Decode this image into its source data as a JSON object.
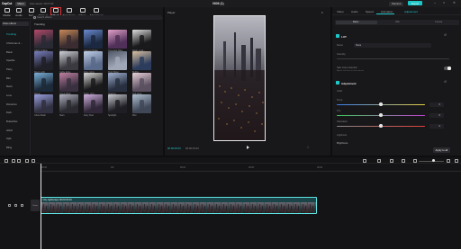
{
  "titlebar": {
    "logo": "CapCut",
    "menu": "Menu",
    "autosave": "Auto saved: 16:07:00",
    "title": "0808 (1)",
    "shortcut": "Shortcut",
    "export": "Export"
  },
  "toolbar": {
    "items": [
      {
        "label": "Media"
      },
      {
        "label": "Audio"
      },
      {
        "label": "Text"
      },
      {
        "label": "Stickers"
      },
      {
        "label": "Effects"
      },
      {
        "label": "Transitions"
      },
      {
        "label": "Filters"
      },
      {
        "label": "Adjustment"
      }
    ]
  },
  "sidebar": {
    "head": "Video effects",
    "items": [
      "Trending",
      "Christmas & ...",
      "Basic",
      "Sparkle",
      "Party",
      "Blur",
      "Retro",
      "Love",
      "Distortion",
      "Dark",
      "Butterflies",
      "Glitch",
      "Split",
      "Bling"
    ]
  },
  "search": {
    "placeholder": "Search effects"
  },
  "effects": {
    "section": "Trending",
    "cards": [
      "Glitch Collage",
      "Shaking",
      "Camera Shake",
      "Cinematic Bars",
      "Flash_Lock...",
      "Disco Light",
      "Cable Edge",
      "Edge Glow",
      "Fluid Water",
      "Bubble",
      "Ripple",
      "Cloud Mask",
      "Flash_lock...",
      "Shaking",
      "Soft Glow",
      "Ghost Flash",
      "Stars",
      "Fairy Dust",
      "Spotlight",
      "Mist"
    ]
  },
  "player": {
    "label": "Player",
    "current_time": "00:00:00:00",
    "total_time": "00:00:03:20"
  },
  "right": {
    "tabs": [
      "Video",
      "Audio",
      "Speed",
      "Animation",
      "Adjustment"
    ],
    "active_tab": "Adjustment",
    "segments": [
      "Basic",
      "HSL",
      "Curves"
    ],
    "lut_label": "LUT",
    "name_label": "Name",
    "name_value": "None",
    "intensity_label": "Intensity",
    "skintone_label": "Skin tone protection",
    "skintone_hint": "Adjust skin tone to look natural",
    "adjustment_label": "Adjustment",
    "color_label": "Color",
    "temp_label": "Temp",
    "tint_label": "Tint",
    "saturation_label": "Saturation",
    "lightness_label": "Lightness",
    "brightness_label": "Brightness",
    "temp_value": "0",
    "tint_value": "0",
    "saturation_value": "0",
    "apply_all": "Apply to all"
  },
  "timeline": {
    "ticks": [
      "00:00",
      "10f",
      "00:01",
      "00:02",
      "00:03"
    ],
    "clip_title": "City nightscape 00:00:03:20",
    "cover_label": "Cover"
  }
}
